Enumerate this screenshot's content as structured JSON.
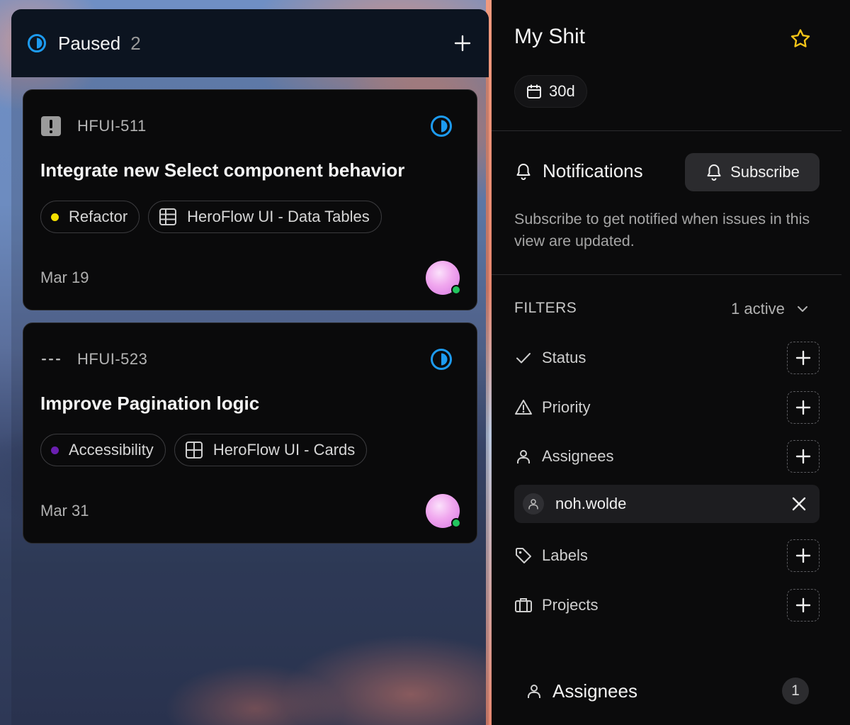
{
  "column": {
    "title": "Paused",
    "count": "2"
  },
  "cards": [
    {
      "id": "HFUI-511",
      "title": "Integrate new Select component behavior",
      "priority_icon": "urgent-icon",
      "label": "Refactor",
      "label_color": "#f5e000",
      "project": "HeroFlow UI - Data Tables",
      "date": "Mar 19"
    },
    {
      "id": "HFUI-523",
      "title": "Improve Pagination logic",
      "priority_icon": "no-priority-icon",
      "label": "Accessibility",
      "label_color": "#6a1fb0",
      "project": "HeroFlow UI - Cards",
      "date": "Mar 31"
    }
  ],
  "panel": {
    "title": "My Shit",
    "range": "30d",
    "notifications": {
      "heading": "Notifications",
      "subscribe_label": "Subscribe",
      "description": "Subscribe to get notified when issues in this view are updated."
    },
    "filters": {
      "label": "FILTERS",
      "active": "1 active",
      "items": [
        {
          "label": "Status",
          "icon": "check-icon"
        },
        {
          "label": "Priority",
          "icon": "warning-icon"
        },
        {
          "label": "Assignees",
          "icon": "user-icon"
        },
        {
          "label": "Labels",
          "icon": "tag-icon"
        },
        {
          "label": "Projects",
          "icon": "briefcase-icon"
        }
      ],
      "assignee_value": "noh.wolde"
    },
    "bottom": {
      "label": "Assignees",
      "count": "1"
    }
  },
  "colors": {
    "status_blue": "#1d9bf0",
    "star_yellow": "#f5c518",
    "online_green": "#22c55e"
  }
}
